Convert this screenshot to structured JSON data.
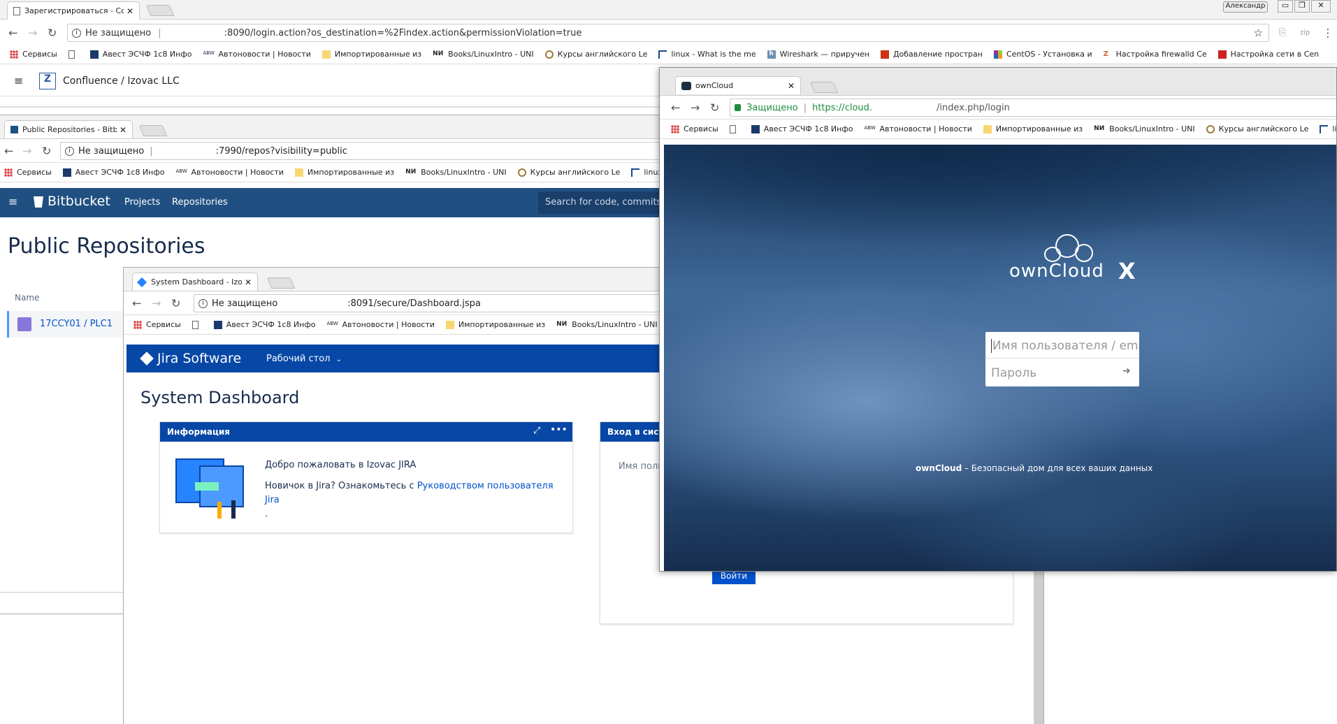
{
  "outer_window": {
    "tab_title": "Зарегистрироваться - Con",
    "user_badge": "Александр",
    "insecure_label": "Не защищено",
    "url": ":8090/login.action?os_destination=%2Findex.action&permissionViolation=true",
    "app_title": "Confluence / Izovac LLC"
  },
  "bookmarks": [
    {
      "label": "Сервисы",
      "icon": "apps-icon"
    },
    {
      "label": "",
      "icon": "page-icon"
    },
    {
      "label": "Авест ЭСЧФ 1с8 Инфо",
      "icon": "avest-icon"
    },
    {
      "label": "Автоновости | Новости",
      "icon": "abw-icon"
    },
    {
      "label": "Импортированные из",
      "icon": "folder-icon"
    },
    {
      "label": "Books/LinuxIntro - UNI",
      "icon": "nii-icon"
    },
    {
      "label": "Курсы английского Le",
      "icon": "lesson-icon"
    },
    {
      "label": "linux - What is the me",
      "icon": "bracket-icon"
    },
    {
      "label": "Wireshark — приручен",
      "icon": "h-icon"
    },
    {
      "label": "Добавление простран",
      "icon": "red-icon"
    },
    {
      "label": "CentOS - Установка и",
      "icon": "centos-icon"
    },
    {
      "label": "Настройка firewalld Ce",
      "icon": "zz-icon"
    },
    {
      "label": "Настройка сети в Cen",
      "icon": "monitor-icon"
    }
  ],
  "bitbucket": {
    "tab_title": "Public Repositories - Bitbuc",
    "insecure_label": "Не защищено",
    "url": ":7990/repos?visibility=public",
    "logo": "Bitbucket",
    "nav": [
      "Projects",
      "Repositories"
    ],
    "search_placeholder": "Search for code, commits o",
    "heading": "Public Repositories",
    "col_name": "Name",
    "repo": "17CCY01 / PLC1"
  },
  "jira": {
    "tab_title": "System Dashboard - Izovac",
    "insecure_label": "Не защищено",
    "url": ":8091/secure/Dashboard.jspa",
    "logo": "Jira Software",
    "menu": "Рабочий стол",
    "heading": "System Dashboard",
    "info_title": "Информация",
    "welcome": "Добро пожаловать в Izovac JIRA",
    "newbie_prefix": "Новичок в Jira? Ознакомьтесь с ",
    "newbie_link": "Руководством пользователя Jira",
    "newbie_suffix": ".",
    "login_title": "Вход в систему",
    "login_user_placeholder": "Имя польз",
    "login_button": "Войти"
  },
  "owncloud": {
    "tab_title": "ownCloud",
    "secure_label": "Защищено",
    "url_prefix": "https://cloud.",
    "url_suffix": "/index.php/login",
    "logo_text": "ownCloud",
    "logo_x": "X",
    "username_placeholder": "Имя пользователя / email",
    "password_placeholder": "Пароль",
    "footer_brand": "ownCloud",
    "footer_text": " – Безопасный дом для всех ваших данных"
  }
}
